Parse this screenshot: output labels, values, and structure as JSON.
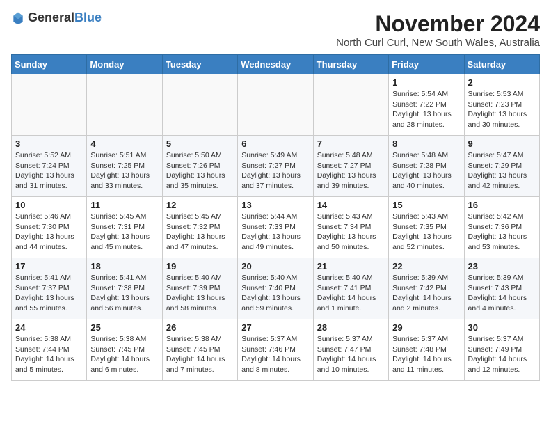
{
  "header": {
    "logo_general": "General",
    "logo_blue": "Blue",
    "month": "November 2024",
    "location": "North Curl Curl, New South Wales, Australia"
  },
  "weekdays": [
    "Sunday",
    "Monday",
    "Tuesday",
    "Wednesday",
    "Thursday",
    "Friday",
    "Saturday"
  ],
  "weeks": [
    [
      {
        "day": "",
        "info": ""
      },
      {
        "day": "",
        "info": ""
      },
      {
        "day": "",
        "info": ""
      },
      {
        "day": "",
        "info": ""
      },
      {
        "day": "",
        "info": ""
      },
      {
        "day": "1",
        "info": "Sunrise: 5:54 AM\nSunset: 7:22 PM\nDaylight: 13 hours and 28 minutes."
      },
      {
        "day": "2",
        "info": "Sunrise: 5:53 AM\nSunset: 7:23 PM\nDaylight: 13 hours and 30 minutes."
      }
    ],
    [
      {
        "day": "3",
        "info": "Sunrise: 5:52 AM\nSunset: 7:24 PM\nDaylight: 13 hours and 31 minutes."
      },
      {
        "day": "4",
        "info": "Sunrise: 5:51 AM\nSunset: 7:25 PM\nDaylight: 13 hours and 33 minutes."
      },
      {
        "day": "5",
        "info": "Sunrise: 5:50 AM\nSunset: 7:26 PM\nDaylight: 13 hours and 35 minutes."
      },
      {
        "day": "6",
        "info": "Sunrise: 5:49 AM\nSunset: 7:27 PM\nDaylight: 13 hours and 37 minutes."
      },
      {
        "day": "7",
        "info": "Sunrise: 5:48 AM\nSunset: 7:27 PM\nDaylight: 13 hours and 39 minutes."
      },
      {
        "day": "8",
        "info": "Sunrise: 5:48 AM\nSunset: 7:28 PM\nDaylight: 13 hours and 40 minutes."
      },
      {
        "day": "9",
        "info": "Sunrise: 5:47 AM\nSunset: 7:29 PM\nDaylight: 13 hours and 42 minutes."
      }
    ],
    [
      {
        "day": "10",
        "info": "Sunrise: 5:46 AM\nSunset: 7:30 PM\nDaylight: 13 hours and 44 minutes."
      },
      {
        "day": "11",
        "info": "Sunrise: 5:45 AM\nSunset: 7:31 PM\nDaylight: 13 hours and 45 minutes."
      },
      {
        "day": "12",
        "info": "Sunrise: 5:45 AM\nSunset: 7:32 PM\nDaylight: 13 hours and 47 minutes."
      },
      {
        "day": "13",
        "info": "Sunrise: 5:44 AM\nSunset: 7:33 PM\nDaylight: 13 hours and 49 minutes."
      },
      {
        "day": "14",
        "info": "Sunrise: 5:43 AM\nSunset: 7:34 PM\nDaylight: 13 hours and 50 minutes."
      },
      {
        "day": "15",
        "info": "Sunrise: 5:43 AM\nSunset: 7:35 PM\nDaylight: 13 hours and 52 minutes."
      },
      {
        "day": "16",
        "info": "Sunrise: 5:42 AM\nSunset: 7:36 PM\nDaylight: 13 hours and 53 minutes."
      }
    ],
    [
      {
        "day": "17",
        "info": "Sunrise: 5:41 AM\nSunset: 7:37 PM\nDaylight: 13 hours and 55 minutes."
      },
      {
        "day": "18",
        "info": "Sunrise: 5:41 AM\nSunset: 7:38 PM\nDaylight: 13 hours and 56 minutes."
      },
      {
        "day": "19",
        "info": "Sunrise: 5:40 AM\nSunset: 7:39 PM\nDaylight: 13 hours and 58 minutes."
      },
      {
        "day": "20",
        "info": "Sunrise: 5:40 AM\nSunset: 7:40 PM\nDaylight: 13 hours and 59 minutes."
      },
      {
        "day": "21",
        "info": "Sunrise: 5:40 AM\nSunset: 7:41 PM\nDaylight: 14 hours and 1 minute."
      },
      {
        "day": "22",
        "info": "Sunrise: 5:39 AM\nSunset: 7:42 PM\nDaylight: 14 hours and 2 minutes."
      },
      {
        "day": "23",
        "info": "Sunrise: 5:39 AM\nSunset: 7:43 PM\nDaylight: 14 hours and 4 minutes."
      }
    ],
    [
      {
        "day": "24",
        "info": "Sunrise: 5:38 AM\nSunset: 7:44 PM\nDaylight: 14 hours and 5 minutes."
      },
      {
        "day": "25",
        "info": "Sunrise: 5:38 AM\nSunset: 7:45 PM\nDaylight: 14 hours and 6 minutes."
      },
      {
        "day": "26",
        "info": "Sunrise: 5:38 AM\nSunset: 7:45 PM\nDaylight: 14 hours and 7 minutes."
      },
      {
        "day": "27",
        "info": "Sunrise: 5:37 AM\nSunset: 7:46 PM\nDaylight: 14 hours and 8 minutes."
      },
      {
        "day": "28",
        "info": "Sunrise: 5:37 AM\nSunset: 7:47 PM\nDaylight: 14 hours and 10 minutes."
      },
      {
        "day": "29",
        "info": "Sunrise: 5:37 AM\nSunset: 7:48 PM\nDaylight: 14 hours and 11 minutes."
      },
      {
        "day": "30",
        "info": "Sunrise: 5:37 AM\nSunset: 7:49 PM\nDaylight: 14 hours and 12 minutes."
      }
    ]
  ]
}
